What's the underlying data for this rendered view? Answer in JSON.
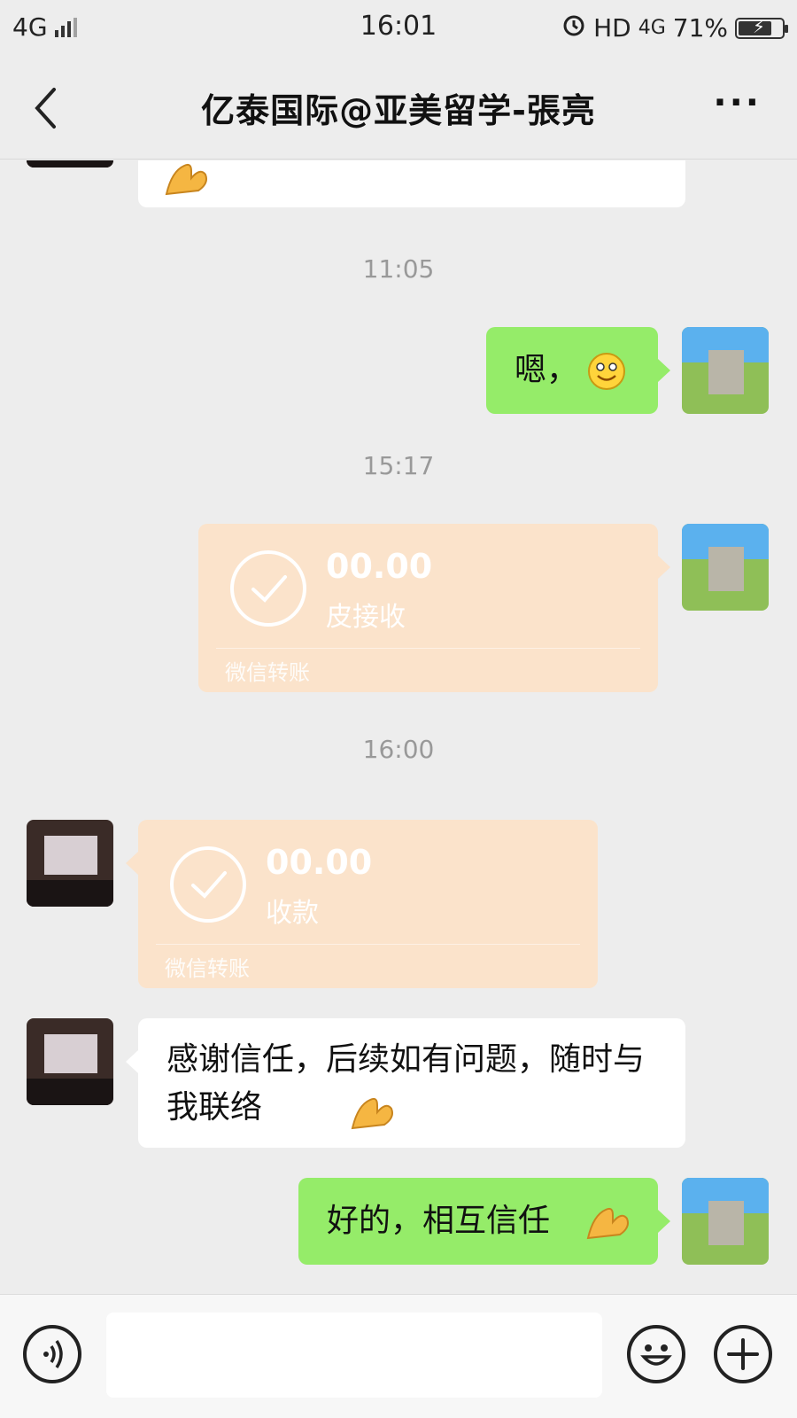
{
  "status_bar": {
    "network": "4G",
    "time": "16:01",
    "hd": "HD",
    "network_right": "4G",
    "battery": "71%"
  },
  "nav": {
    "title": "亿泰国际@亚美留学-張亮",
    "back_icon": "chevron-left-icon",
    "more_icon": "more-icon",
    "more_glyph": "···"
  },
  "messages": {
    "ts1": "11:05",
    "msg1": "嗯，",
    "ts2": "15:17",
    "transfer1": {
      "amount": "00.00",
      "status": "皮接收",
      "label": "微信转账"
    },
    "ts3": "16:00",
    "transfer2": {
      "amount": "00.00",
      "status": "收款",
      "label": "微信转账"
    },
    "msg2": "感谢信任，后续如有问题，随时与我联络",
    "msg3": "好的，相互信任"
  },
  "colors": {
    "bg": "#ededed",
    "green_bubble": "#95ec69",
    "white_bubble": "#ffffff",
    "transfer_bubble": "#fbe3cb"
  }
}
